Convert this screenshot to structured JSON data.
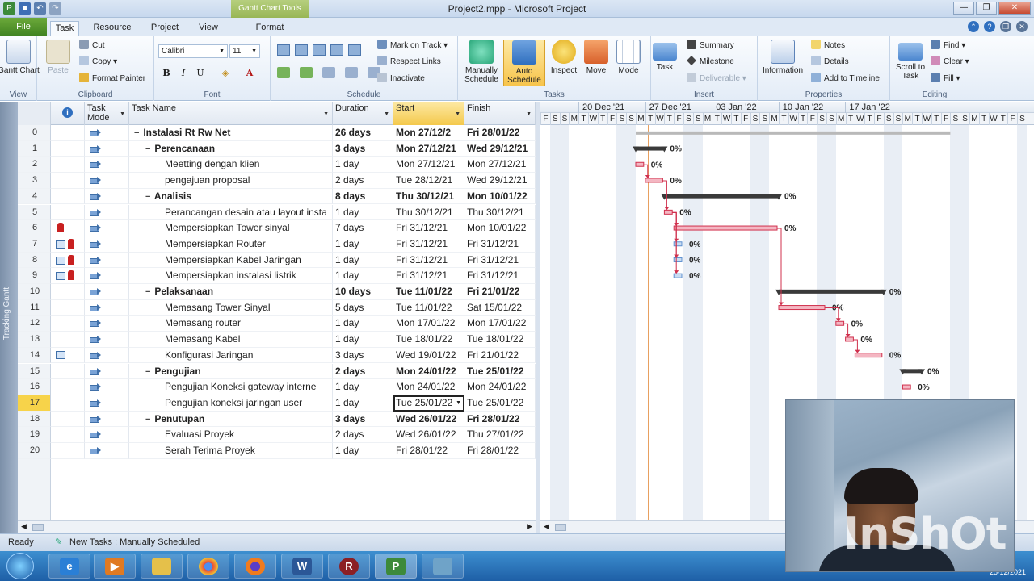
{
  "window": {
    "title": "Project2.mpp - Microsoft Project",
    "context_tools": "Gantt Chart Tools"
  },
  "tabs": {
    "file": "File",
    "task": "Task",
    "resource": "Resource",
    "project": "Project",
    "view": "View",
    "format": "Format"
  },
  "ribbon": {
    "gantt_chart": "Gantt Chart",
    "paste": "Paste",
    "cut": "Cut",
    "copy": "Copy",
    "format_painter": "Format Painter",
    "font_name": "Calibri",
    "font_size": "11",
    "mark_on_track": "Mark on Track",
    "respect_links": "Respect Links",
    "inactivate": "Inactivate",
    "manually_schedule": "Manually Schedule",
    "auto_schedule": "Auto Schedule",
    "inspect": "Inspect",
    "move": "Move",
    "mode": "Mode",
    "task": "Task",
    "summary": "Summary",
    "milestone": "Milestone",
    "deliverable": "Deliverable",
    "information": "Information",
    "notes": "Notes",
    "details": "Details",
    "add_to_timeline": "Add to Timeline",
    "scroll_to_task": "Scroll to Task",
    "find": "Find",
    "clear": "Clear",
    "fill": "Fill",
    "groups": {
      "view": "View",
      "clipboard": "Clipboard",
      "font": "Font",
      "schedule": "Schedule",
      "tasks": "Tasks",
      "insert": "Insert",
      "properties": "Properties",
      "editing": "Editing"
    }
  },
  "sidebar_label": "Tracking Gantt",
  "columns": {
    "mode": "Task Mode",
    "name": "Task Name",
    "duration": "Duration",
    "start": "Start",
    "finish": "Finish"
  },
  "tasks": [
    {
      "id": "0",
      "name": "Instalasi Rt Rw Net",
      "duration": "26 days",
      "start": "Mon 27/12/2",
      "finish": "Fri 28/01/22",
      "level": 0,
      "summary": true,
      "ind": ""
    },
    {
      "id": "1",
      "name": "Perencanaan",
      "duration": "3 days",
      "start": "Mon 27/12/21",
      "finish": "Wed 29/12/21",
      "level": 1,
      "summary": true,
      "ind": ""
    },
    {
      "id": "2",
      "name": "Meetting dengan klien",
      "duration": "1 day",
      "start": "Mon 27/12/21",
      "finish": "Mon 27/12/21",
      "level": 2,
      "summary": false,
      "ind": ""
    },
    {
      "id": "3",
      "name": "pengajuan proposal",
      "duration": "2 days",
      "start": "Tue 28/12/21",
      "finish": "Wed 29/12/21",
      "level": 2,
      "summary": false,
      "ind": ""
    },
    {
      "id": "4",
      "name": "Analisis",
      "duration": "8 days",
      "start": "Thu 30/12/21",
      "finish": "Mon 10/01/22",
      "level": 1,
      "summary": true,
      "ind": ""
    },
    {
      "id": "5",
      "name": "Perancangan desain atau layout insta",
      "duration": "1 day",
      "start": "Thu 30/12/21",
      "finish": "Thu 30/12/21",
      "level": 2,
      "summary": false,
      "ind": ""
    },
    {
      "id": "6",
      "name": "Mempersiapkan Tower sinyal",
      "duration": "7 days",
      "start": "Fri 31/12/21",
      "finish": "Mon 10/01/22",
      "level": 2,
      "summary": false,
      "ind": "person"
    },
    {
      "id": "7",
      "name": "Mempersiapkan Router",
      "duration": "1 day",
      "start": "Fri 31/12/21",
      "finish": "Fri 31/12/21",
      "level": 2,
      "summary": false,
      "ind": "both"
    },
    {
      "id": "8",
      "name": "Mempersiapkan Kabel Jaringan",
      "duration": "1 day",
      "start": "Fri 31/12/21",
      "finish": "Fri 31/12/21",
      "level": 2,
      "summary": false,
      "ind": "both"
    },
    {
      "id": "9",
      "name": "Mempersiapkan instalasi listrik",
      "duration": "1 day",
      "start": "Fri 31/12/21",
      "finish": "Fri 31/12/21",
      "level": 2,
      "summary": false,
      "ind": "both"
    },
    {
      "id": "10",
      "name": "Pelaksanaan",
      "duration": "10 days",
      "start": "Tue 11/01/22",
      "finish": "Fri 21/01/22",
      "level": 1,
      "summary": true,
      "ind": ""
    },
    {
      "id": "11",
      "name": "Memasang Tower Sinyal",
      "duration": "5 days",
      "start": "Tue 11/01/22",
      "finish": "Sat 15/01/22",
      "level": 2,
      "summary": false,
      "ind": ""
    },
    {
      "id": "12",
      "name": "Memasang router",
      "duration": "1 day",
      "start": "Mon 17/01/22",
      "finish": "Mon 17/01/22",
      "level": 2,
      "summary": false,
      "ind": ""
    },
    {
      "id": "13",
      "name": "Memasang Kabel",
      "duration": "1 day",
      "start": "Tue 18/01/22",
      "finish": "Tue 18/01/22",
      "level": 2,
      "summary": false,
      "ind": ""
    },
    {
      "id": "14",
      "name": "Konfigurasi Jaringan",
      "duration": "3 days",
      "start": "Wed 19/01/22",
      "finish": "Fri 21/01/22",
      "level": 2,
      "summary": false,
      "ind": "cal"
    },
    {
      "id": "15",
      "name": "Pengujian",
      "duration": "2 days",
      "start": "Mon 24/01/22",
      "finish": "Tue 25/01/22",
      "level": 1,
      "summary": true,
      "ind": ""
    },
    {
      "id": "16",
      "name": "Pengujian Koneksi gateway interne",
      "duration": "1 day",
      "start": "Mon 24/01/22",
      "finish": "Mon 24/01/22",
      "level": 2,
      "summary": false,
      "ind": ""
    },
    {
      "id": "17",
      "name": "Pengujian koneksi jaringan user",
      "duration": "1 day",
      "start": "Tue 25/01/22",
      "finish": "Tue 25/01/22",
      "level": 2,
      "summary": false,
      "ind": ""
    },
    {
      "id": "18",
      "name": "Penutupan",
      "duration": "3 days",
      "start": "Wed 26/01/22",
      "finish": "Fri 28/01/22",
      "level": 1,
      "summary": true,
      "ind": ""
    },
    {
      "id": "19",
      "name": "Evaluasi Proyek",
      "duration": "2 days",
      "start": "Wed 26/01/22",
      "finish": "Thu 27/01/22",
      "level": 2,
      "summary": false,
      "ind": ""
    },
    {
      "id": "20",
      "name": "Serah Terima Proyek",
      "duration": "1 day",
      "start": "Fri 28/01/22",
      "finish": "Fri 28/01/22",
      "level": 2,
      "summary": false,
      "ind": ""
    }
  ],
  "selected_row": "17",
  "timescale": {
    "weeks": [
      "20 Dec '21",
      "27 Dec '21",
      "03 Jan '22",
      "10 Jan '22",
      "17 Jan '22"
    ],
    "day_letters": [
      "F",
      "S",
      "S",
      "M",
      "T",
      "W",
      "T",
      "F",
      "S",
      "S",
      "M",
      "T",
      "W",
      "T",
      "F",
      "S",
      "S",
      "M",
      "T",
      "W",
      "T",
      "F",
      "S",
      "S",
      "M",
      "T",
      "W",
      "T",
      "F",
      "S",
      "S",
      "M",
      "T",
      "W",
      "T",
      "F",
      "S",
      "S",
      "M",
      "T",
      "W",
      "T",
      "F",
      "S",
      "S",
      "M",
      "T",
      "W",
      "T",
      "F",
      "S"
    ]
  },
  "gantt_pct": "0%",
  "status": {
    "ready": "Ready",
    "new_tasks": "New Tasks : Manually Scheduled"
  },
  "watermark": "InShOt",
  "tray_date": "25/12/2021",
  "taskbar_apps": [
    "file-explorer",
    "media-player",
    "folder",
    "chrome",
    "firefox",
    "word",
    "recorder",
    "project",
    "desktop-app"
  ]
}
